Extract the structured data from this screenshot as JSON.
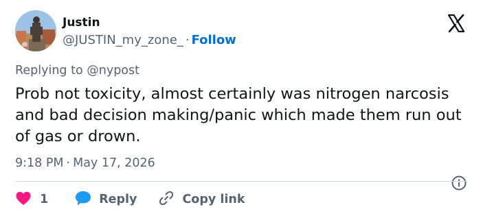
{
  "author": {
    "display_name": "Justin",
    "handle": "@JUSTIN_my_zone_",
    "separator": "·",
    "follow_label": "Follow"
  },
  "reply_context": {
    "prefix": "Replying to",
    "mention": "@nypost"
  },
  "tweet": {
    "text": "Prob not toxicity, almost certainly was nitrogen narcosis and bad decision making/panic which made them run out of gas or drown.",
    "time": "9:18 PM",
    "separator": "·",
    "date": "May 17, 2026"
  },
  "actions": {
    "like_count": "1",
    "reply_label": "Reply",
    "copy_link_label": "Copy link"
  },
  "icons": {
    "platform": "x-logo-icon",
    "info": "info-icon",
    "like": "heart-icon",
    "reply": "speech-bubble-icon",
    "copy": "link-icon"
  },
  "colors": {
    "text_primary": "#0f1419",
    "text_secondary": "#536471",
    "link": "#006fd6",
    "like": "#f91880",
    "reply_bubble": "#1d9bf0",
    "divider": "#cfd9de"
  }
}
